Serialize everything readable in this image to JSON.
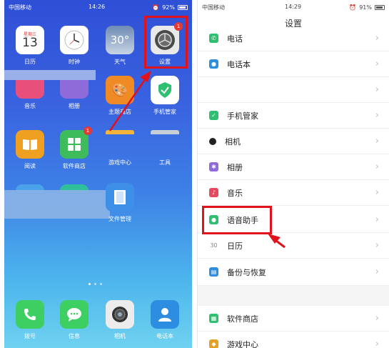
{
  "left": {
    "status": {
      "carrier": "中国移动",
      "time": "14:26",
      "battery": "92%"
    },
    "apps_row1": [
      {
        "label": "日历",
        "date_weekday": "星期三",
        "date_day": "13"
      },
      {
        "label": "时钟"
      },
      {
        "label": "天气",
        "temp": "30°"
      },
      {
        "label": "设置",
        "badge": "1"
      }
    ],
    "apps_row2": [
      {
        "label": "音乐"
      },
      {
        "label": "相册"
      },
      {
        "label": "主题商店"
      },
      {
        "label": "手机管家"
      }
    ],
    "apps_row3": [
      {
        "label": "阅读"
      },
      {
        "label": "软件商店",
        "badge": "1"
      },
      {
        "label": "游戏中心"
      },
      {
        "label": "工具"
      }
    ],
    "apps_row4": [
      {
        "label": "文件管理"
      }
    ],
    "dock": [
      {
        "label": "拨号"
      },
      {
        "label": "信息"
      },
      {
        "label": "相机"
      },
      {
        "label": "电话本"
      }
    ]
  },
  "right": {
    "status": {
      "carrier": "中国移动",
      "time": "14:29",
      "battery": "91%"
    },
    "title": "设置",
    "rows": [
      {
        "label": "电话",
        "color": "#2fbf71"
      },
      {
        "label": "电话本",
        "color": "#2d8de0"
      },
      {
        "label": "",
        "color": ""
      },
      {
        "label": "手机管家",
        "color": "#2fbf71"
      },
      {
        "label": "相机",
        "color": "#222222"
      },
      {
        "label": "相册",
        "color": "#8e6bd8"
      },
      {
        "label": "音乐",
        "color": "#e5485f"
      },
      {
        "label": "语音助手",
        "color": "#2fbf71"
      },
      {
        "label": "日历",
        "color": "#999999",
        "icon_text": "30"
      },
      {
        "label": "备份与恢复",
        "color": "#2d8de0"
      },
      {
        "label": "软件商店",
        "color": "#2fbf71"
      },
      {
        "label": "游戏中心",
        "color": "#e5a027"
      }
    ]
  }
}
